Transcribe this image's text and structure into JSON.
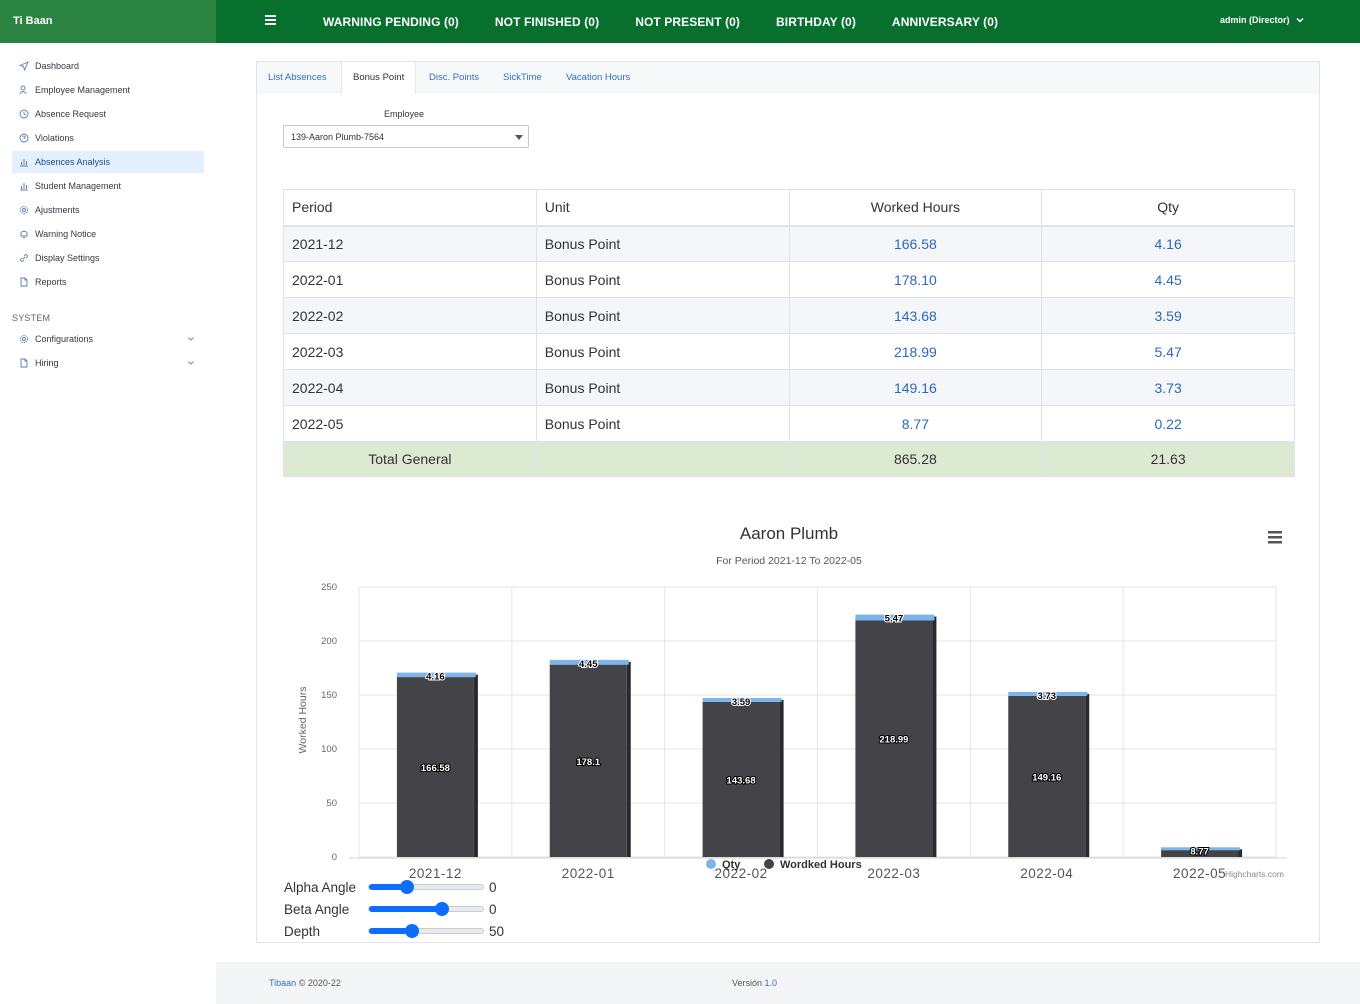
{
  "brand": "Ti Baan",
  "topnav": [
    "WARNING PENDING (0)",
    "NOT FINISHED (0)",
    "NOT PRESENT (0)",
    "BIRTHDAY (0)",
    "ANNIVERSARY (0)"
  ],
  "user": "admin (Director)",
  "sidebar": {
    "items": [
      {
        "label": "Dashboard",
        "icon": "send-icon"
      },
      {
        "label": "Employee Management",
        "icon": "users-icon"
      },
      {
        "label": "Absence Request",
        "icon": "clock-icon"
      },
      {
        "label": "Violations",
        "icon": "help-circle-icon"
      },
      {
        "label": "Absences Analysis",
        "icon": "bar-chart-icon"
      },
      {
        "label": "Student Management",
        "icon": "bar-chart-icon"
      },
      {
        "label": "Ajustments",
        "icon": "gear-icon"
      },
      {
        "label": "Warning Notice",
        "icon": "bell-icon"
      },
      {
        "label": "Display Settings",
        "icon": "link-icon"
      },
      {
        "label": "Reports",
        "icon": "file-icon"
      }
    ],
    "section": "SYSTEM",
    "system_items": [
      {
        "label": "Configurations",
        "icon": "gear-icon"
      },
      {
        "label": "Hiring",
        "icon": "file-icon"
      }
    ]
  },
  "tabs": [
    "List Absences",
    "Bonus Point",
    "Disc. Points",
    "SickTime",
    "Vacation Hours"
  ],
  "employee": {
    "label": "Employee",
    "value": "139-Aaron Plumb-7564"
  },
  "table": {
    "headers": [
      "Period",
      "Unit",
      "Worked Hours",
      "Qty"
    ],
    "rows": [
      [
        "2021-12",
        "Bonus Point",
        "166.58",
        "4.16"
      ],
      [
        "2022-01",
        "Bonus Point",
        "178.10",
        "4.45"
      ],
      [
        "2022-02",
        "Bonus Point",
        "143.68",
        "3.59"
      ],
      [
        "2022-03",
        "Bonus Point",
        "218.99",
        "5.47"
      ],
      [
        "2022-04",
        "Bonus Point",
        "149.16",
        "3.73"
      ],
      [
        "2022-05",
        "Bonus Point",
        "8.77",
        "0.22"
      ]
    ],
    "total": [
      "Total General",
      "",
      "865.28",
      "21.63"
    ]
  },
  "chart_data": {
    "type": "bar",
    "title": "Aaron Plumb",
    "subtitle": "For Period 2021-12 To 2022-05",
    "ylabel": "Worked Hours",
    "ylim": [
      0,
      250
    ],
    "yticks": [
      0,
      50,
      100,
      150,
      200,
      250
    ],
    "categories": [
      "2021-12",
      "2022-01",
      "2022-02",
      "2022-03",
      "2022-04",
      "2022-05"
    ],
    "stacked": true,
    "series": [
      {
        "name": "Qty",
        "color": "#7cb5ec",
        "values": [
          4.16,
          4.45,
          3.59,
          5.47,
          3.73,
          0.22
        ],
        "labels": [
          "4.16",
          "4.45",
          "3.59",
          "5.47",
          "3.73",
          ""
        ]
      },
      {
        "name": "Wordked Hours",
        "color": "#434348",
        "values": [
          166.58,
          178.1,
          143.68,
          218.99,
          149.16,
          8.77
        ],
        "labels": [
          "166.58",
          "178.1",
          "143.68",
          "218.99",
          "149.16",
          "8.77"
        ]
      }
    ],
    "legend": "bottom-center",
    "credits": "Highcharts.com",
    "menu_icon": "hamburger-icon"
  },
  "sliders": [
    {
      "label": "Alpha Angle",
      "value": "0",
      "level": 0.33
    },
    {
      "label": "Beta Angle",
      "value": "0",
      "level": 0.64
    },
    {
      "label": "Depth",
      "value": "50",
      "level": 0.38
    }
  ],
  "footer": {
    "brand": "Tibaan",
    "copyright": "© 2020-22",
    "version_label": "Versión",
    "version": "1.0"
  },
  "colors": {
    "topbar": "#07702f",
    "brand_bg": "#2b8441",
    "link": "#2e69b8",
    "total_row": "#dcead3"
  }
}
